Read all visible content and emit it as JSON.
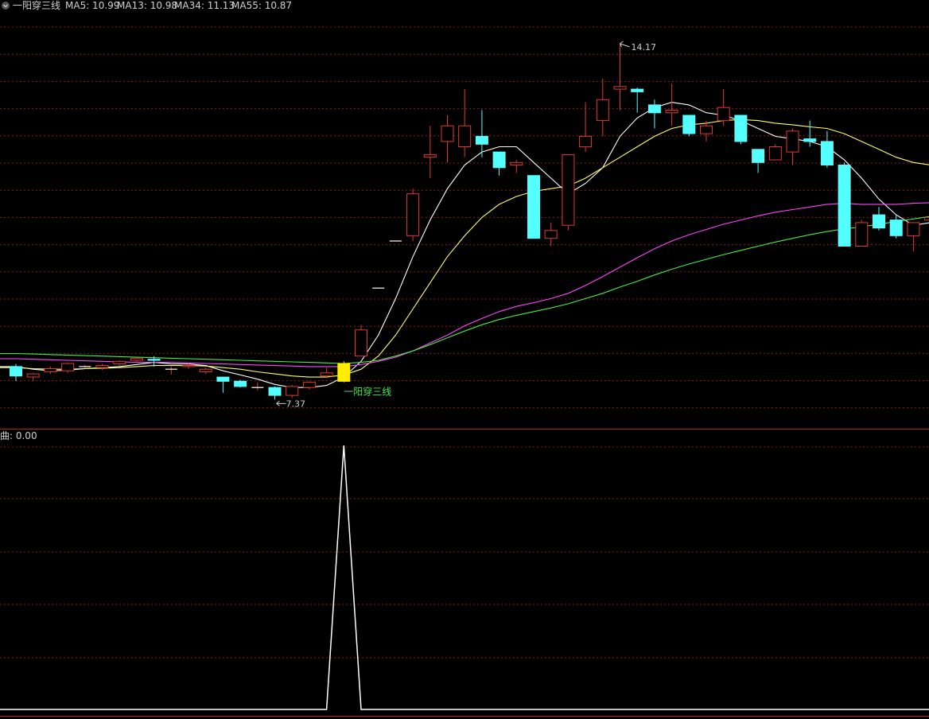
{
  "header": {
    "indicator_name": "一阳穿三线",
    "legend": [
      {
        "label": "MA5: 10.99",
        "color": "#ffffff"
      },
      {
        "label": "MA13: 10.98",
        "color": "#ffff66"
      },
      {
        "label": "MA34: 11.13",
        "color": "#ff44ff"
      },
      {
        "label": "MA55: 10.87",
        "color": "#44ee44"
      }
    ]
  },
  "sub_header": {
    "label": "曲: 0.00"
  },
  "annotations": {
    "low_label": "7.37",
    "high_label": "14.17",
    "signal_label": "一阳穿三线"
  },
  "colors": {
    "up": "#e0392f",
    "down": "#54ffff",
    "signal": "#ffee00",
    "ma5": "#ffffff",
    "ma13": "#ffff66",
    "ma34": "#ff44ff",
    "ma55": "#44ee44",
    "grid": "#8a1c1c",
    "sub_line": "#ffffff"
  },
  "chart_data": [
    {
      "type": "candlestick",
      "y_range": [
        6.95,
        14.7
      ],
      "candles": [
        {
          "o": 8.0,
          "h": 8.05,
          "l": 7.72,
          "c": 7.82
        },
        {
          "o": 7.8,
          "h": 7.88,
          "l": 7.72,
          "c": 7.86
        },
        {
          "o": 7.9,
          "h": 8.0,
          "l": 7.86,
          "c": 7.96
        },
        {
          "o": 7.92,
          "h": 8.08,
          "l": 7.88,
          "c": 8.06
        },
        {
          "o": 8.0,
          "h": 8.03,
          "l": 7.97,
          "c": 8.0
        },
        {
          "o": 7.98,
          "h": 8.05,
          "l": 7.94,
          "c": 8.02
        },
        {
          "o": 8.05,
          "h": 8.12,
          "l": 8.02,
          "c": 8.1
        },
        {
          "o": 8.12,
          "h": 8.18,
          "l": 8.08,
          "c": 8.16
        },
        {
          "o": 8.14,
          "h": 8.2,
          "l": 8.0,
          "c": 8.12
        },
        {
          "o": 7.95,
          "h": 8.0,
          "l": 7.85,
          "c": 7.95
        },
        {
          "o": 8.0,
          "h": 8.08,
          "l": 7.96,
          "c": 8.02
        },
        {
          "o": 7.9,
          "h": 7.98,
          "l": 7.86,
          "c": 7.95
        },
        {
          "o": 7.8,
          "h": 7.8,
          "l": 7.5,
          "c": 7.72
        },
        {
          "o": 7.72,
          "h": 7.75,
          "l": 7.6,
          "c": 7.62
        },
        {
          "o": 7.6,
          "h": 7.7,
          "l": 7.55,
          "c": 7.6
        },
        {
          "o": 7.6,
          "h": 7.62,
          "l": 7.37,
          "c": 7.45
        },
        {
          "o": 7.45,
          "h": 7.65,
          "l": 7.4,
          "c": 7.62
        },
        {
          "o": 7.6,
          "h": 7.72,
          "l": 7.56,
          "c": 7.7
        },
        {
          "o": 7.82,
          "h": 7.98,
          "l": 7.8,
          "c": 7.88
        },
        {
          "o": 7.72,
          "h": 8.1,
          "l": 7.7,
          "c": 8.06,
          "signal": true
        },
        {
          "o": 8.2,
          "h": 8.8,
          "l": 8.2,
          "c": 8.7
        },
        {
          "o": 9.5,
          "h": 9.5,
          "l": 9.5,
          "c": 9.5
        },
        {
          "o": 10.4,
          "h": 10.4,
          "l": 10.4,
          "c": 10.4
        },
        {
          "o": 10.5,
          "h": 11.4,
          "l": 10.4,
          "c": 11.3
        },
        {
          "o": 12.0,
          "h": 12.6,
          "l": 11.6,
          "c": 12.05
        },
        {
          "o": 12.3,
          "h": 12.8,
          "l": 11.9,
          "c": 12.6
        },
        {
          "o": 12.2,
          "h": 13.3,
          "l": 12.0,
          "c": 12.6
        },
        {
          "o": 12.4,
          "h": 12.9,
          "l": 12.0,
          "c": 12.25
        },
        {
          "o": 12.1,
          "h": 12.1,
          "l": 11.65,
          "c": 11.8
        },
        {
          "o": 11.85,
          "h": 11.95,
          "l": 11.7,
          "c": 11.9
        },
        {
          "o": 11.65,
          "h": 11.65,
          "l": 10.45,
          "c": 10.45
        },
        {
          "o": 10.45,
          "h": 10.75,
          "l": 10.3,
          "c": 10.6
        },
        {
          "o": 10.7,
          "h": 12.05,
          "l": 10.6,
          "c": 12.05
        },
        {
          "o": 12.2,
          "h": 13.05,
          "l": 12.1,
          "c": 12.4
        },
        {
          "o": 12.7,
          "h": 13.5,
          "l": 12.4,
          "c": 13.1
        },
        {
          "o": 13.3,
          "h": 14.17,
          "l": 12.9,
          "c": 13.35
        },
        {
          "o": 13.3,
          "h": 13.33,
          "l": 12.85,
          "c": 13.25
        },
        {
          "o": 13.0,
          "h": 13.1,
          "l": 12.55,
          "c": 12.85
        },
        {
          "o": 12.85,
          "h": 13.4,
          "l": 12.6,
          "c": 12.9
        },
        {
          "o": 12.8,
          "h": 12.8,
          "l": 12.4,
          "c": 12.45
        },
        {
          "o": 12.45,
          "h": 12.7,
          "l": 12.3,
          "c": 12.6
        },
        {
          "o": 12.7,
          "h": 13.3,
          "l": 12.6,
          "c": 12.95
        },
        {
          "o": 12.8,
          "h": 12.8,
          "l": 12.25,
          "c": 12.3
        },
        {
          "o": 12.15,
          "h": 12.15,
          "l": 11.7,
          "c": 11.9
        },
        {
          "o": 11.95,
          "h": 12.25,
          "l": 11.95,
          "c": 12.2
        },
        {
          "o": 12.1,
          "h": 12.55,
          "l": 11.85,
          "c": 12.5
        },
        {
          "o": 12.35,
          "h": 12.7,
          "l": 12.2,
          "c": 12.3
        },
        {
          "o": 12.3,
          "h": 12.5,
          "l": 11.8,
          "c": 11.85
        },
        {
          "o": 11.85,
          "h": 11.9,
          "l": 10.3,
          "c": 10.3
        },
        {
          "o": 10.3,
          "h": 10.8,
          "l": 10.3,
          "c": 10.75
        },
        {
          "o": 10.9,
          "h": 11.05,
          "l": 10.6,
          "c": 10.65
        },
        {
          "o": 10.8,
          "h": 10.9,
          "l": 10.45,
          "c": 10.5
        },
        {
          "o": 10.5,
          "h": 10.75,
          "l": 10.2,
          "c": 10.75
        },
        {
          "o": 10.8,
          "h": 10.85,
          "l": 10.5,
          "c": 10.85
        }
      ],
      "ma": {
        "MA5": [
          8.0,
          7.95,
          7.92,
          7.93,
          7.96,
          7.98,
          8.0,
          8.04,
          8.08,
          8.05,
          8.05,
          8.02,
          7.92,
          7.84,
          7.76,
          7.66,
          7.6,
          7.6,
          7.64,
          7.8,
          8.1,
          8.6,
          9.3,
          10.1,
          10.8,
          11.4,
          11.85,
          12.1,
          12.2,
          12.2,
          11.9,
          11.6,
          11.3,
          11.5,
          11.8,
          12.4,
          12.75,
          12.95,
          13.05,
          13.0,
          12.85,
          12.8,
          12.7,
          12.55,
          12.4,
          12.35,
          12.3,
          12.2,
          11.95,
          11.6,
          11.2,
          10.9,
          10.7,
          10.75
        ],
        "MA13": [
          7.98,
          7.96,
          7.95,
          7.95,
          7.96,
          7.97,
          7.98,
          8.0,
          8.02,
          8.02,
          8.02,
          8.01,
          7.98,
          7.95,
          7.9,
          7.86,
          7.82,
          7.8,
          7.8,
          7.84,
          7.95,
          8.2,
          8.6,
          9.1,
          9.6,
          10.1,
          10.5,
          10.85,
          11.1,
          11.25,
          11.35,
          11.4,
          11.45,
          11.6,
          11.8,
          12.0,
          12.2,
          12.4,
          12.55,
          12.62,
          12.65,
          12.7,
          12.72,
          12.7,
          12.65,
          12.62,
          12.58,
          12.55,
          12.45,
          12.3,
          12.15,
          12.0,
          11.9,
          11.85
        ],
        "MA34": [
          8.15,
          8.14,
          8.13,
          8.12,
          8.11,
          8.1,
          8.09,
          8.08,
          8.08,
          8.08,
          8.07,
          8.06,
          8.05,
          8.04,
          8.03,
          8.02,
          8.01,
          8.0,
          8.0,
          8.0,
          8.04,
          8.1,
          8.18,
          8.3,
          8.45,
          8.6,
          8.78,
          8.92,
          9.05,
          9.15,
          9.22,
          9.3,
          9.4,
          9.55,
          9.72,
          9.9,
          10.08,
          10.25,
          10.4,
          10.52,
          10.62,
          10.72,
          10.8,
          10.88,
          10.95,
          11.0,
          11.05,
          11.1,
          11.12,
          11.1,
          11.1,
          11.1,
          11.12,
          11.13
        ],
        "MA55": [
          8.25,
          8.24,
          8.23,
          8.22,
          8.21,
          8.2,
          8.19,
          8.18,
          8.17,
          8.16,
          8.15,
          8.14,
          8.13,
          8.12,
          8.11,
          8.1,
          8.09,
          8.08,
          8.07,
          8.06,
          8.08,
          8.12,
          8.2,
          8.3,
          8.42,
          8.55,
          8.68,
          8.8,
          8.9,
          8.98,
          9.05,
          9.12,
          9.2,
          9.3,
          9.4,
          9.52,
          9.63,
          9.75,
          9.86,
          9.96,
          10.05,
          10.14,
          10.22,
          10.3,
          10.38,
          10.45,
          10.52,
          10.58,
          10.63,
          10.67,
          10.72,
          10.77,
          10.82,
          10.87
        ]
      }
    },
    {
      "type": "line",
      "title": "曲",
      "y_range": [
        0,
        1
      ],
      "values": [
        0,
        0,
        0,
        0,
        0,
        0,
        0,
        0,
        0,
        0,
        0,
        0,
        0,
        0,
        0,
        0,
        0,
        0,
        0,
        1,
        0,
        0,
        0,
        0,
        0,
        0,
        0,
        0,
        0,
        0,
        0,
        0,
        0,
        0,
        0,
        0,
        0,
        0,
        0,
        0,
        0,
        0,
        0,
        0,
        0,
        0,
        0,
        0,
        0,
        0,
        0,
        0,
        0,
        0
      ]
    }
  ]
}
